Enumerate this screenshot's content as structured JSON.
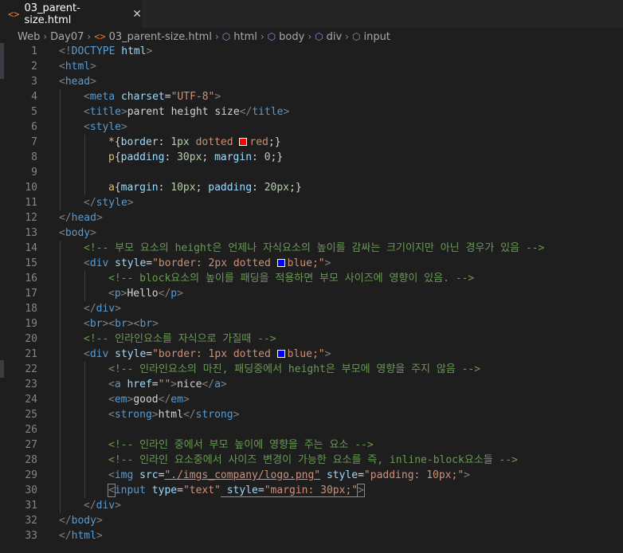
{
  "tab": {
    "icon": "html-file-icon",
    "label": "03_parent-size.html",
    "close_glyph": "✕"
  },
  "breadcrumb": [
    {
      "label": "Web",
      "icon": ""
    },
    {
      "label": "Day07",
      "icon": ""
    },
    {
      "label": "03_parent-size.html",
      "icon": "html-file-icon"
    },
    {
      "label": "html",
      "icon": "element-cube-icon"
    },
    {
      "label": "body",
      "icon": "element-cube-icon"
    },
    {
      "label": "div",
      "icon": "element-cube-icon"
    },
    {
      "label": "input",
      "icon": "element-cube-icon"
    }
  ],
  "colors": {
    "editor_bg": "#1e1e1e",
    "tag": "#569cd6",
    "attr": "#9cdcfe",
    "string": "#ce9178",
    "comment": "#6a9955",
    "number": "#b5cea8",
    "swatch_red": "#ff0000",
    "swatch_blue": "#0000ff"
  },
  "lines": [
    {
      "n": "1",
      "indent": 0,
      "tokens": [
        [
          "t",
          "<!"
        ],
        [
          "tn",
          "DOCTYPE"
        ],
        [
          "pn",
          " "
        ],
        [
          "an",
          "html"
        ],
        [
          "t",
          ">"
        ]
      ]
    },
    {
      "n": "2",
      "indent": 0,
      "tokens": [
        [
          "t",
          "<"
        ],
        [
          "tn",
          "html"
        ],
        [
          "t",
          ">"
        ]
      ]
    },
    {
      "n": "3",
      "indent": 0,
      "tokens": [
        [
          "t",
          "<"
        ],
        [
          "tn",
          "head"
        ],
        [
          "t",
          ">"
        ]
      ]
    },
    {
      "n": "4",
      "indent": 1,
      "tokens": [
        [
          "t",
          "<"
        ],
        [
          "tn",
          "meta"
        ],
        [
          "pn",
          " "
        ],
        [
          "an",
          "charset"
        ],
        [
          "pn",
          "="
        ],
        [
          "av",
          "\"UTF-8\""
        ],
        [
          "t",
          ">"
        ]
      ]
    },
    {
      "n": "5",
      "indent": 1,
      "tokens": [
        [
          "t",
          "<"
        ],
        [
          "tn",
          "title"
        ],
        [
          "t",
          ">"
        ],
        [
          "pn",
          "parent height size"
        ],
        [
          "t",
          "</"
        ],
        [
          "tn",
          "title"
        ],
        [
          "t",
          ">"
        ]
      ]
    },
    {
      "n": "6",
      "indent": 1,
      "tokens": [
        [
          "t",
          "<"
        ],
        [
          "tn",
          "style"
        ],
        [
          "t",
          ">"
        ]
      ]
    },
    {
      "n": "7",
      "indent": 2,
      "tokens": [
        [
          "sel",
          "*"
        ],
        [
          "pn",
          "{"
        ],
        [
          "pr",
          "border"
        ],
        [
          "pn",
          ": "
        ],
        [
          "nm",
          "1px"
        ],
        [
          "pn",
          " "
        ],
        [
          "vl",
          "dotted"
        ],
        [
          "pn",
          " "
        ],
        [
          "swatch",
          "#ff0000"
        ],
        [
          "vl",
          "red"
        ],
        [
          "pn",
          ";}"
        ]
      ]
    },
    {
      "n": "8",
      "indent": 2,
      "tokens": [
        [
          "sel",
          "p"
        ],
        [
          "pn",
          "{"
        ],
        [
          "pr",
          "padding"
        ],
        [
          "pn",
          ": "
        ],
        [
          "nm",
          "30px"
        ],
        [
          "pn",
          "; "
        ],
        [
          "pr",
          "margin"
        ],
        [
          "pn",
          ": "
        ],
        [
          "nm",
          "0"
        ],
        [
          "pn",
          ";}"
        ]
      ]
    },
    {
      "n": "9",
      "indent": 2,
      "tokens": []
    },
    {
      "n": "10",
      "indent": 2,
      "tokens": [
        [
          "sel",
          "a"
        ],
        [
          "pn",
          "{"
        ],
        [
          "pr",
          "margin"
        ],
        [
          "pn",
          ": "
        ],
        [
          "nm",
          "10px"
        ],
        [
          "pn",
          "; "
        ],
        [
          "pr",
          "padding"
        ],
        [
          "pn",
          ": "
        ],
        [
          "nm",
          "20px"
        ],
        [
          "pn",
          ";}"
        ]
      ]
    },
    {
      "n": "11",
      "indent": 1,
      "tokens": [
        [
          "t",
          "</"
        ],
        [
          "tn",
          "style"
        ],
        [
          "t",
          ">"
        ]
      ]
    },
    {
      "n": "12",
      "indent": 0,
      "tokens": [
        [
          "t",
          "</"
        ],
        [
          "tn",
          "head"
        ],
        [
          "t",
          ">"
        ]
      ]
    },
    {
      "n": "13",
      "indent": 0,
      "tokens": [
        [
          "t",
          "<"
        ],
        [
          "tn",
          "body"
        ],
        [
          "t",
          ">"
        ]
      ]
    },
    {
      "n": "14",
      "indent": 1,
      "tokens": [
        [
          "cm",
          "<!-- 부모 요소의 height은 언제나 자식요소의 높이를 감싸는 크기이지만 아닌 경우가 있음 -->"
        ]
      ]
    },
    {
      "n": "15",
      "indent": 1,
      "tokens": [
        [
          "t",
          "<"
        ],
        [
          "tn",
          "div"
        ],
        [
          "pn",
          " "
        ],
        [
          "an",
          "style"
        ],
        [
          "pn",
          "="
        ],
        [
          "av",
          "\"border: 2px dotted "
        ],
        [
          "swatch",
          "#0000ff"
        ],
        [
          "av",
          "blue;\""
        ],
        [
          "t",
          ">"
        ]
      ]
    },
    {
      "n": "16",
      "indent": 2,
      "tokens": [
        [
          "cm",
          "<!-- block요소의 높이를 패딩을 적용하면 부모 사이즈에 영향이 있음. -->"
        ]
      ]
    },
    {
      "n": "17",
      "indent": 2,
      "tokens": [
        [
          "t",
          "<"
        ],
        [
          "tn",
          "p"
        ],
        [
          "t",
          ">"
        ],
        [
          "pn",
          "Hello"
        ],
        [
          "t",
          "</"
        ],
        [
          "tn",
          "p"
        ],
        [
          "t",
          ">"
        ]
      ]
    },
    {
      "n": "18",
      "indent": 1,
      "tokens": [
        [
          "t",
          "</"
        ],
        [
          "tn",
          "div"
        ],
        [
          "t",
          ">"
        ]
      ]
    },
    {
      "n": "19",
      "indent": 1,
      "tokens": [
        [
          "t",
          "<"
        ],
        [
          "tn",
          "br"
        ],
        [
          "t",
          "><"
        ],
        [
          "tn",
          "br"
        ],
        [
          "t",
          "><"
        ],
        [
          "tn",
          "br"
        ],
        [
          "t",
          ">"
        ]
      ]
    },
    {
      "n": "20",
      "indent": 1,
      "tokens": [
        [
          "cm",
          "<!-- 인라인요소를 자식으로 가질때 -->"
        ]
      ]
    },
    {
      "n": "21",
      "indent": 1,
      "tokens": [
        [
          "t",
          "<"
        ],
        [
          "tn",
          "div"
        ],
        [
          "pn",
          " "
        ],
        [
          "an",
          "style"
        ],
        [
          "pn",
          "="
        ],
        [
          "av",
          "\"border: 1px dotted "
        ],
        [
          "swatch",
          "#0000ff"
        ],
        [
          "av",
          "blue;\""
        ],
        [
          "t",
          ">"
        ]
      ]
    },
    {
      "n": "22",
      "indent": 2,
      "tokens": [
        [
          "cm",
          "<!-- 인라인요소의 마진, 패딩중에서 height은 부모에 영향을 주지 않음 -->"
        ]
      ]
    },
    {
      "n": "23",
      "indent": 2,
      "tokens": [
        [
          "t",
          "<"
        ],
        [
          "tn",
          "a"
        ],
        [
          "pn",
          " "
        ],
        [
          "an",
          "href"
        ],
        [
          "pn",
          "="
        ],
        [
          "av",
          "\"\""
        ],
        [
          "t",
          ">"
        ],
        [
          "pn",
          "nice"
        ],
        [
          "t",
          "</"
        ],
        [
          "tn",
          "a"
        ],
        [
          "t",
          ">"
        ]
      ]
    },
    {
      "n": "24",
      "indent": 2,
      "tokens": [
        [
          "t",
          "<"
        ],
        [
          "tn",
          "em"
        ],
        [
          "t",
          ">"
        ],
        [
          "pn",
          "good"
        ],
        [
          "t",
          "</"
        ],
        [
          "tn",
          "em"
        ],
        [
          "t",
          ">"
        ]
      ]
    },
    {
      "n": "25",
      "indent": 2,
      "tokens": [
        [
          "t",
          "<"
        ],
        [
          "tn",
          "strong"
        ],
        [
          "t",
          ">"
        ],
        [
          "pn",
          "html"
        ],
        [
          "t",
          "</"
        ],
        [
          "tn",
          "strong"
        ],
        [
          "t",
          ">"
        ]
      ]
    },
    {
      "n": "26",
      "indent": 2,
      "tokens": []
    },
    {
      "n": "27",
      "indent": 2,
      "tokens": [
        [
          "cm",
          "<!-- 인라인 중에서 부모 높이에 영향을 주는 요소 -->"
        ]
      ]
    },
    {
      "n": "28",
      "indent": 2,
      "tokens": [
        [
          "cm",
          "<!-- 인라인 요소중에서 사이즈 변경이 가능한 요소를 즉, inline-block요소들 -->"
        ]
      ]
    },
    {
      "n": "29",
      "indent": 2,
      "tokens": [
        [
          "t",
          "<"
        ],
        [
          "tn",
          "img"
        ],
        [
          "pn",
          " "
        ],
        [
          "an",
          "src"
        ],
        [
          "pn",
          "="
        ],
        [
          "avu",
          "\"./imgs_company/logo.png\""
        ],
        [
          "pn",
          " "
        ],
        [
          "an",
          "style"
        ],
        [
          "pn",
          "="
        ],
        [
          "av",
          "\"padding: 10px;\""
        ],
        [
          "t",
          ">"
        ]
      ]
    },
    {
      "n": "30",
      "indent": 2,
      "tokens": [
        [
          "tbox",
          "<"
        ],
        [
          "tn",
          "input"
        ],
        [
          "pn",
          " "
        ],
        [
          "an",
          "type"
        ],
        [
          "pn",
          "="
        ],
        [
          "av",
          "\"text\""
        ],
        [
          "sq",
          " "
        ],
        [
          "sqan",
          "style"
        ],
        [
          "sqpn",
          "="
        ],
        [
          "sqav",
          "\"margin: 30px;\""
        ],
        [
          "tbox",
          ">"
        ]
      ]
    },
    {
      "n": "31",
      "indent": 1,
      "tokens": [
        [
          "t",
          "</"
        ],
        [
          "tn",
          "div"
        ],
        [
          "t",
          ">"
        ]
      ]
    },
    {
      "n": "32",
      "indent": 0,
      "tokens": [
        [
          "t",
          "</"
        ],
        [
          "tn",
          "body"
        ],
        [
          "t",
          ">"
        ]
      ]
    },
    {
      "n": "33",
      "indent": 0,
      "tokens": [
        [
          "t",
          "</"
        ],
        [
          "tn",
          "html"
        ],
        [
          "t",
          ">"
        ]
      ]
    }
  ]
}
